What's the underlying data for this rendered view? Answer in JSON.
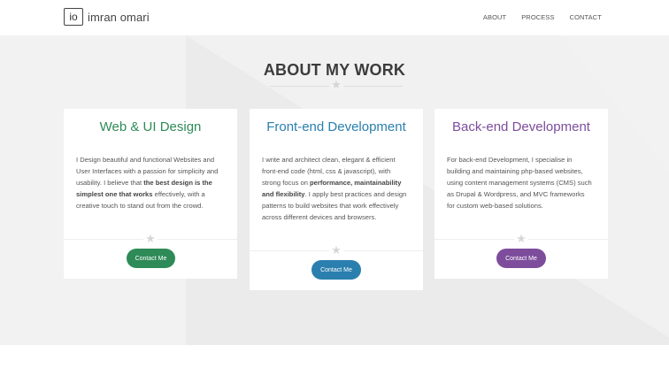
{
  "header": {
    "logo_mark": "io",
    "logo_text": "imran omari",
    "nav": [
      "ABOUT",
      "PROCESS",
      "CONTACT"
    ]
  },
  "section": {
    "title": "ABOUT MY WORK"
  },
  "cards": [
    {
      "title": "Web & UI Design",
      "color": "#2e8b57",
      "text_before": "I Design beautiful and functional Websites and User Interfaces with a passion for simplicity and usability. I believe that ",
      "text_bold": "the best design is the simplest one that works",
      "text_after": " effectively, with a creative touch to stand out from the crowd.",
      "button": "Contact Me"
    },
    {
      "title": "Front-end Development",
      "color": "#2a7fae",
      "text_before": "I write and architect clean, elegant & efficient front-end code (html, css & javascript), with strong focus on ",
      "text_bold": "performance, maintainability and flexibility",
      "text_after": ". I apply best practices and design patterns to build websites that work effectively across different devices and browsers.",
      "button": "Contact Me"
    },
    {
      "title": "Back-end Development",
      "color": "#7d4d9c",
      "text_before": "For back-end Development, I specialise in building and maintaining php-based websites, using content management systems (CMS) such as Drupal & Wordpress, and MVC frameworks for custom web-based solutions.",
      "text_bold": "",
      "text_after": "",
      "button": "Contact Me"
    }
  ]
}
